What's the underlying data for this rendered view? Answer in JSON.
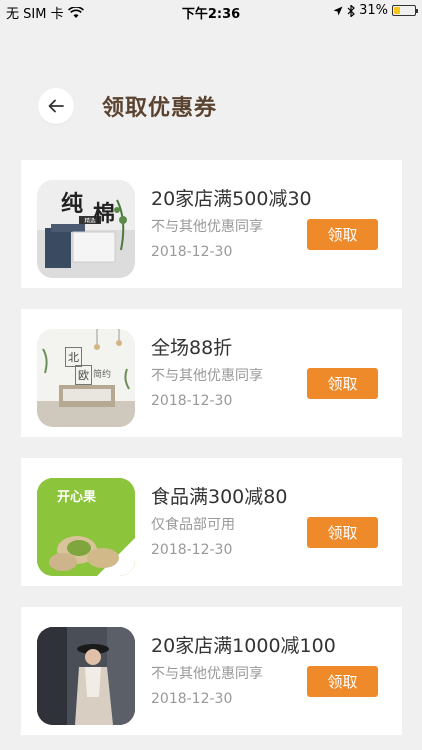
{
  "status_bar": {
    "carrier": "无 SIM 卡",
    "time": "下午2:36",
    "battery": "31%",
    "battery_level": 0.31
  },
  "header": {
    "title": "领取优惠券",
    "back_icon": "arrow-left-icon"
  },
  "coupons": [
    {
      "title": "20家店满500减30",
      "description": "不与其他优惠同享",
      "date": "2018-12-30",
      "button_label": "领取",
      "thumb_text": [
        "纯",
        "棉"
      ]
    },
    {
      "title": "全场88折",
      "description": "不与其他优惠同享",
      "date": "2018-12-30",
      "button_label": "领取",
      "thumb_text": [
        "北",
        "欧",
        "简约"
      ]
    },
    {
      "title": "食品满300减80",
      "description": "仅食品部可用",
      "date": "2018-12-30",
      "button_label": "领取",
      "thumb_text": [
        "开心果"
      ]
    },
    {
      "title": "20家店满1000减100",
      "description": "不与其他优惠同享",
      "date": "2018-12-30",
      "button_label": "领取",
      "thumb_text": []
    }
  ],
  "colors": {
    "accent": "#ef8a2a",
    "title": "#5a4330",
    "background": "#f0f0f0"
  }
}
